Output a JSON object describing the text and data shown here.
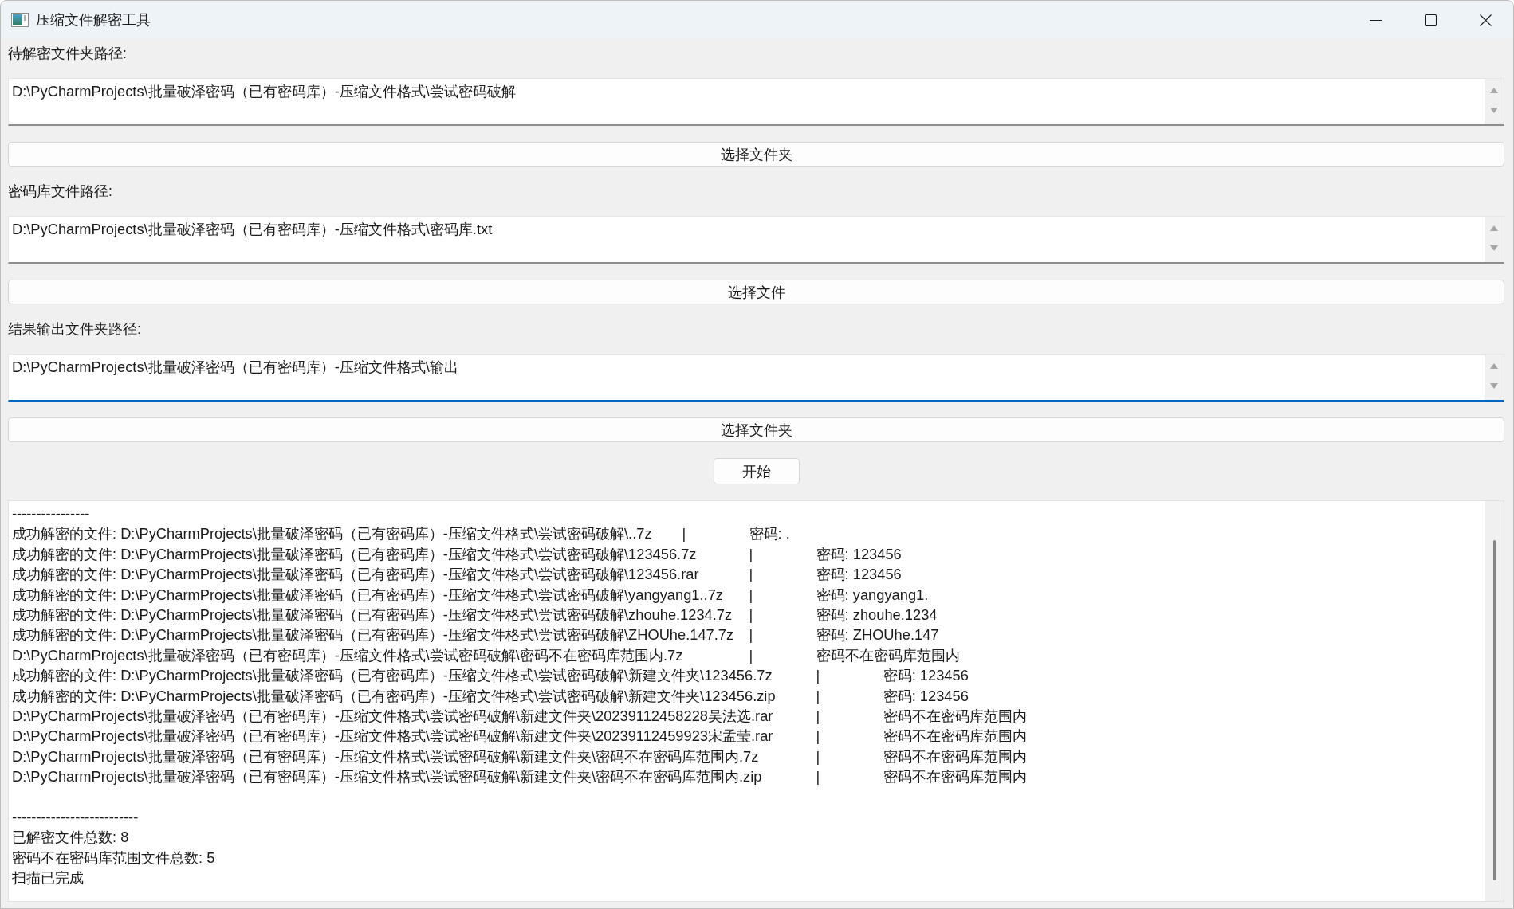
{
  "window": {
    "title": "压缩文件解密工具"
  },
  "fields": [
    {
      "label": "待解密文件夹路径:",
      "value": "D:\\PyCharmProjects\\批量破泽密码（已有密码库）-压缩文件格式\\尝试密码破解",
      "focused": false,
      "button": "选择文件夹"
    },
    {
      "label": "密码库文件路径:",
      "value": "D:\\PyCharmProjects\\批量破泽密码（已有密码库）-压缩文件格式\\密码库.txt",
      "focused": false,
      "button": "选择文件"
    },
    {
      "label": "结果输出文件夹路径:",
      "value": "D:\\PyCharmProjects\\批量破泽密码（已有密码库）-压缩文件格式\\输出",
      "focused": true,
      "button": "选择文件夹"
    }
  ],
  "start_button": "开始",
  "log": {
    "lines": [
      {
        "kind": "text",
        "text": "----------------"
      },
      {
        "kind": "entry",
        "text": "成功解密的文件: D:\\PyCharmProjects\\批量破泽密码（已有密码库）-压缩文件格式\\尝试密码破解\\..7z",
        "separator": "|",
        "result": "密码: ."
      },
      {
        "kind": "entry",
        "text": "成功解密的文件: D:\\PyCharmProjects\\批量破泽密码（已有密码库）-压缩文件格式\\尝试密码破解\\123456.7z",
        "separator": "|",
        "result": "密码: 123456"
      },
      {
        "kind": "entry",
        "text": "成功解密的文件: D:\\PyCharmProjects\\批量破泽密码（已有密码库）-压缩文件格式\\尝试密码破解\\123456.rar",
        "separator": "|",
        "result": "密码: 123456"
      },
      {
        "kind": "entry",
        "text": "成功解密的文件: D:\\PyCharmProjects\\批量破泽密码（已有密码库）-压缩文件格式\\尝试密码破解\\yangyang1..7z",
        "separator": "|",
        "result": "密码: yangyang1."
      },
      {
        "kind": "entry",
        "text": "成功解密的文件: D:\\PyCharmProjects\\批量破泽密码（已有密码库）-压缩文件格式\\尝试密码破解\\zhouhe.1234.7z",
        "separator": "|",
        "result": "密码: zhouhe.1234"
      },
      {
        "kind": "entry",
        "text": "成功解密的文件: D:\\PyCharmProjects\\批量破泽密码（已有密码库）-压缩文件格式\\尝试密码破解\\ZHOUhe.147.7z",
        "separator": "|",
        "result": "密码: ZHOUhe.147"
      },
      {
        "kind": "entry",
        "text": "D:\\PyCharmProjects\\批量破泽密码（已有密码库）-压缩文件格式\\尝试密码破解\\密码不在密码库范围内.7z",
        "separator": "|",
        "result": "密码不在密码库范围内"
      },
      {
        "kind": "entry",
        "text": "成功解密的文件: D:\\PyCharmProjects\\批量破泽密码（已有密码库）-压缩文件格式\\尝试密码破解\\新建文件夹\\123456.7z",
        "separator": "|",
        "result": "密码: 123456"
      },
      {
        "kind": "entry",
        "text": "成功解密的文件: D:\\PyCharmProjects\\批量破泽密码（已有密码库）-压缩文件格式\\尝试密码破解\\新建文件夹\\123456.zip",
        "separator": "|",
        "result": "密码: 123456"
      },
      {
        "kind": "entry",
        "text": "D:\\PyCharmProjects\\批量破泽密码（已有密码库）-压缩文件格式\\尝试密码破解\\新建文件夹\\20239112458228吴法选.rar",
        "separator": "|",
        "result": "密码不在密码库范围内"
      },
      {
        "kind": "entry",
        "text": "D:\\PyCharmProjects\\批量破泽密码（已有密码库）-压缩文件格式\\尝试密码破解\\新建文件夹\\20239112459923宋孟莹.rar",
        "separator": "|",
        "result": "密码不在密码库范围内"
      },
      {
        "kind": "entry",
        "text": "D:\\PyCharmProjects\\批量破泽密码（已有密码库）-压缩文件格式\\尝试密码破解\\新建文件夹\\密码不在密码库范围内.7z",
        "separator": "|",
        "result": "密码不在密码库范围内"
      },
      {
        "kind": "entry",
        "text": "D:\\PyCharmProjects\\批量破泽密码（已有密码库）-压缩文件格式\\尝试密码破解\\新建文件夹\\密码不在密码库范围内.zip",
        "separator": "|",
        "result": "密码不在密码库范围内"
      },
      {
        "kind": "blank"
      },
      {
        "kind": "text",
        "text": "--------------------------"
      },
      {
        "kind": "text",
        "text": "已解密文件总数: 8"
      },
      {
        "kind": "text",
        "text": "密码不在密码库范围文件总数: 5"
      },
      {
        "kind": "text",
        "text": "扫描已完成"
      }
    ]
  }
}
